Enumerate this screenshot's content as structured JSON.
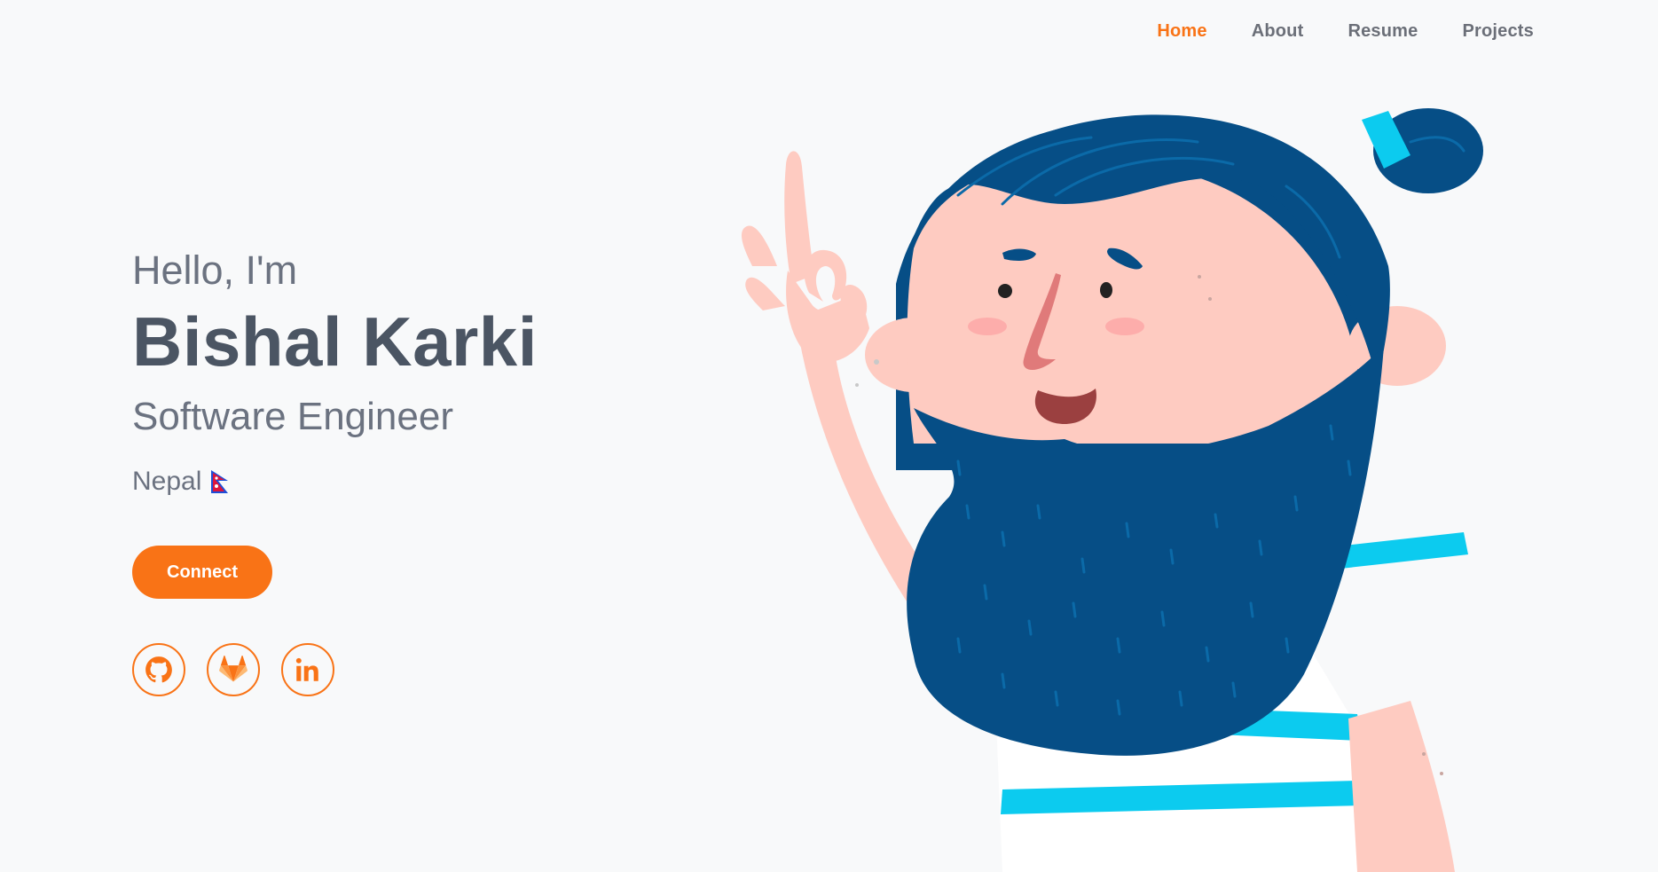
{
  "nav": {
    "items": [
      {
        "label": "Home",
        "active": true
      },
      {
        "label": "About",
        "active": false
      },
      {
        "label": "Resume",
        "active": false
      },
      {
        "label": "Projects",
        "active": false
      }
    ]
  },
  "hero": {
    "greeting": "Hello, I'm",
    "name": "Bishal Karki",
    "role": "Software Engineer",
    "location": "Nepal",
    "flag_icon": "nepal-flag-icon",
    "connect_label": "Connect"
  },
  "socials": [
    {
      "name": "GitHub",
      "icon": "github-icon"
    },
    {
      "name": "GitLab",
      "icon": "gitlab-icon"
    },
    {
      "name": "LinkedIn",
      "icon": "linkedin-icon"
    }
  ],
  "colors": {
    "accent": "#f97316",
    "background": "#f8f9fa",
    "heading": "#4b5563",
    "text": "#6b7280",
    "hair": "#064e86",
    "skin": "#fecbc1",
    "stripe": "#0ccbef"
  }
}
